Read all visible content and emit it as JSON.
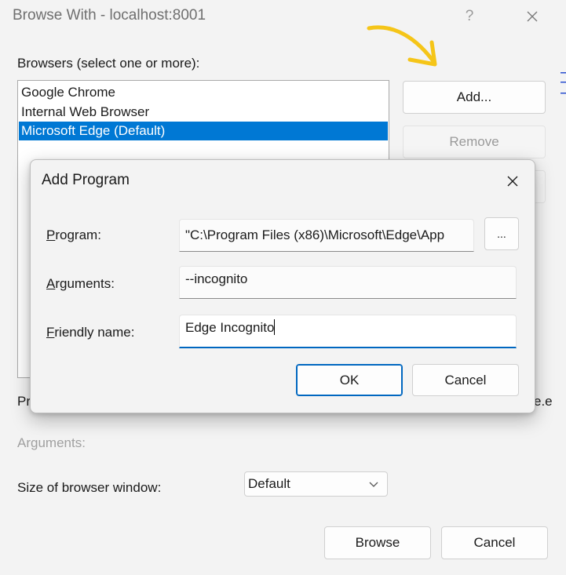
{
  "outer_dialog": {
    "title": "Browse With - localhost:8001",
    "help_symbol": "?",
    "browsers_label": "Browsers (select one or more):",
    "browsers": [
      {
        "label": "Google Chrome",
        "selected": false
      },
      {
        "label": "Internal Web Browser",
        "selected": false
      },
      {
        "label": "Microsoft Edge (Default)",
        "selected": true
      }
    ],
    "add_button": "Add...",
    "remove_button": "Remove",
    "program_label_partial": "Pr",
    "program_value_partial": "e.e",
    "arguments_label": "Arguments:",
    "window_size_label": "Size of browser window:",
    "window_size_value": "Default",
    "browse_button": "Browse",
    "cancel_button": "Cancel"
  },
  "add_program_dialog": {
    "title": "Add Program",
    "program_label_mnemonic": "P",
    "program_label_rest": "rogram:",
    "program_value": "\"C:\\Program Files (x86)\\Microsoft\\Edge\\App",
    "browse_button": "...",
    "arguments_label_mnemonic": "A",
    "arguments_label_rest": "rguments:",
    "arguments_value": "--incognito",
    "friendly_label_mnemonic": "F",
    "friendly_label_rest": "riendly name:",
    "friendly_value": "Edge Incognito",
    "ok_button": "OK",
    "cancel_button": "Cancel"
  },
  "colors": {
    "accent": "#0078d4",
    "annotation_arrow": "#f5c518"
  }
}
